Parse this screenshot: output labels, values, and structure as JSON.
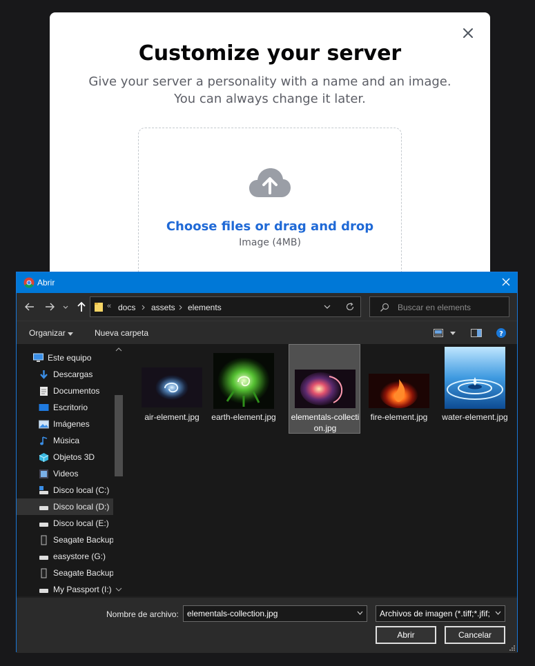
{
  "modal": {
    "title": "Customize your server",
    "subtitle": "Give your server a personality with a name and an image. You can always change it later.",
    "upload_link": "Choose files or drag and drop",
    "upload_hint": "Image (4MB)"
  },
  "dialog": {
    "title": "Abrir",
    "breadcrumb_prefix": "«",
    "breadcrumb": [
      "docs",
      "assets",
      "elements"
    ],
    "search_placeholder": "Buscar en elements",
    "organize": "Organizar",
    "new_folder": "Nueva carpeta",
    "sidebar": [
      {
        "label": "Este equipo",
        "icon": "computer-icon"
      },
      {
        "label": "Descargas",
        "icon": "download-icon"
      },
      {
        "label": "Documentos",
        "icon": "documents-icon"
      },
      {
        "label": "Escritorio",
        "icon": "desktop-icon"
      },
      {
        "label": "Imágenes",
        "icon": "pictures-icon"
      },
      {
        "label": "Música",
        "icon": "music-icon"
      },
      {
        "label": "Objetos 3D",
        "icon": "objects-3d-icon"
      },
      {
        "label": "Videos",
        "icon": "videos-icon"
      },
      {
        "label": "Disco local (C:)",
        "icon": "drive-c-icon"
      },
      {
        "label": "Disco local (D:)",
        "icon": "drive-icon"
      },
      {
        "label": "Disco local (E:)",
        "icon": "drive-icon"
      },
      {
        "label": "Seagate Backup",
        "icon": "external-drive-icon"
      },
      {
        "label": "easystore (G:)",
        "icon": "drive-icon"
      },
      {
        "label": "Seagate Backup",
        "icon": "external-drive-icon"
      },
      {
        "label": "My Passport (I:)",
        "icon": "drive-icon"
      }
    ],
    "selected_sidebar_index": 9,
    "files": [
      {
        "name": "air-element.jpg"
      },
      {
        "name": "earth-element.jpg"
      },
      {
        "name": "elementals-collection.jpg"
      },
      {
        "name": "fire-element.jpg"
      },
      {
        "name": "water-element.jpg"
      }
    ],
    "selected_file_index": 2,
    "filename_label": "Nombre de archivo:",
    "filename_value": "elementals-collection.jpg",
    "filter_value": "Archivos de imagen (*.tiff;*.jfif;",
    "open_label": "Abrir",
    "cancel_label": "Cancelar"
  },
  "colors": {
    "accent": "#0078d7",
    "link": "#1f69d6"
  }
}
